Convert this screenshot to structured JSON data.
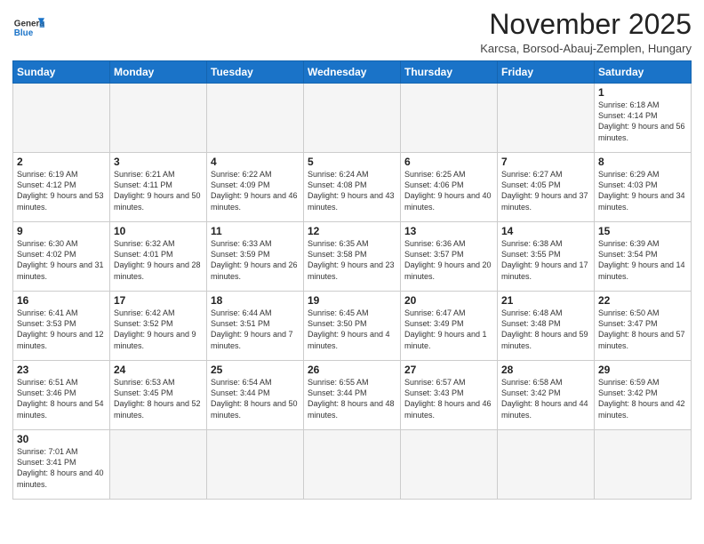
{
  "header": {
    "logo_general": "General",
    "logo_blue": "Blue",
    "month_title": "November 2025",
    "location": "Karcsa, Borsod-Abauj-Zemplen, Hungary"
  },
  "weekdays": [
    "Sunday",
    "Monday",
    "Tuesday",
    "Wednesday",
    "Thursday",
    "Friday",
    "Saturday"
  ],
  "weeks": [
    [
      {
        "day": "",
        "info": ""
      },
      {
        "day": "",
        "info": ""
      },
      {
        "day": "",
        "info": ""
      },
      {
        "day": "",
        "info": ""
      },
      {
        "day": "",
        "info": ""
      },
      {
        "day": "",
        "info": ""
      },
      {
        "day": "1",
        "info": "Sunrise: 6:18 AM\nSunset: 4:14 PM\nDaylight: 9 hours and 56 minutes."
      }
    ],
    [
      {
        "day": "2",
        "info": "Sunrise: 6:19 AM\nSunset: 4:12 PM\nDaylight: 9 hours and 53 minutes."
      },
      {
        "day": "3",
        "info": "Sunrise: 6:21 AM\nSunset: 4:11 PM\nDaylight: 9 hours and 50 minutes."
      },
      {
        "day": "4",
        "info": "Sunrise: 6:22 AM\nSunset: 4:09 PM\nDaylight: 9 hours and 46 minutes."
      },
      {
        "day": "5",
        "info": "Sunrise: 6:24 AM\nSunset: 4:08 PM\nDaylight: 9 hours and 43 minutes."
      },
      {
        "day": "6",
        "info": "Sunrise: 6:25 AM\nSunset: 4:06 PM\nDaylight: 9 hours and 40 minutes."
      },
      {
        "day": "7",
        "info": "Sunrise: 6:27 AM\nSunset: 4:05 PM\nDaylight: 9 hours and 37 minutes."
      },
      {
        "day": "8",
        "info": "Sunrise: 6:29 AM\nSunset: 4:03 PM\nDaylight: 9 hours and 34 minutes."
      }
    ],
    [
      {
        "day": "9",
        "info": "Sunrise: 6:30 AM\nSunset: 4:02 PM\nDaylight: 9 hours and 31 minutes."
      },
      {
        "day": "10",
        "info": "Sunrise: 6:32 AM\nSunset: 4:01 PM\nDaylight: 9 hours and 28 minutes."
      },
      {
        "day": "11",
        "info": "Sunrise: 6:33 AM\nSunset: 3:59 PM\nDaylight: 9 hours and 26 minutes."
      },
      {
        "day": "12",
        "info": "Sunrise: 6:35 AM\nSunset: 3:58 PM\nDaylight: 9 hours and 23 minutes."
      },
      {
        "day": "13",
        "info": "Sunrise: 6:36 AM\nSunset: 3:57 PM\nDaylight: 9 hours and 20 minutes."
      },
      {
        "day": "14",
        "info": "Sunrise: 6:38 AM\nSunset: 3:55 PM\nDaylight: 9 hours and 17 minutes."
      },
      {
        "day": "15",
        "info": "Sunrise: 6:39 AM\nSunset: 3:54 PM\nDaylight: 9 hours and 14 minutes."
      }
    ],
    [
      {
        "day": "16",
        "info": "Sunrise: 6:41 AM\nSunset: 3:53 PM\nDaylight: 9 hours and 12 minutes."
      },
      {
        "day": "17",
        "info": "Sunrise: 6:42 AM\nSunset: 3:52 PM\nDaylight: 9 hours and 9 minutes."
      },
      {
        "day": "18",
        "info": "Sunrise: 6:44 AM\nSunset: 3:51 PM\nDaylight: 9 hours and 7 minutes."
      },
      {
        "day": "19",
        "info": "Sunrise: 6:45 AM\nSunset: 3:50 PM\nDaylight: 9 hours and 4 minutes."
      },
      {
        "day": "20",
        "info": "Sunrise: 6:47 AM\nSunset: 3:49 PM\nDaylight: 9 hours and 1 minute."
      },
      {
        "day": "21",
        "info": "Sunrise: 6:48 AM\nSunset: 3:48 PM\nDaylight: 8 hours and 59 minutes."
      },
      {
        "day": "22",
        "info": "Sunrise: 6:50 AM\nSunset: 3:47 PM\nDaylight: 8 hours and 57 minutes."
      }
    ],
    [
      {
        "day": "23",
        "info": "Sunrise: 6:51 AM\nSunset: 3:46 PM\nDaylight: 8 hours and 54 minutes."
      },
      {
        "day": "24",
        "info": "Sunrise: 6:53 AM\nSunset: 3:45 PM\nDaylight: 8 hours and 52 minutes."
      },
      {
        "day": "25",
        "info": "Sunrise: 6:54 AM\nSunset: 3:44 PM\nDaylight: 8 hours and 50 minutes."
      },
      {
        "day": "26",
        "info": "Sunrise: 6:55 AM\nSunset: 3:44 PM\nDaylight: 8 hours and 48 minutes."
      },
      {
        "day": "27",
        "info": "Sunrise: 6:57 AM\nSunset: 3:43 PM\nDaylight: 8 hours and 46 minutes."
      },
      {
        "day": "28",
        "info": "Sunrise: 6:58 AM\nSunset: 3:42 PM\nDaylight: 8 hours and 44 minutes."
      },
      {
        "day": "29",
        "info": "Sunrise: 6:59 AM\nSunset: 3:42 PM\nDaylight: 8 hours and 42 minutes."
      }
    ],
    [
      {
        "day": "30",
        "info": "Sunrise: 7:01 AM\nSunset: 3:41 PM\nDaylight: 8 hours and 40 minutes."
      },
      {
        "day": "",
        "info": ""
      },
      {
        "day": "",
        "info": ""
      },
      {
        "day": "",
        "info": ""
      },
      {
        "day": "",
        "info": ""
      },
      {
        "day": "",
        "info": ""
      },
      {
        "day": "",
        "info": ""
      }
    ]
  ]
}
